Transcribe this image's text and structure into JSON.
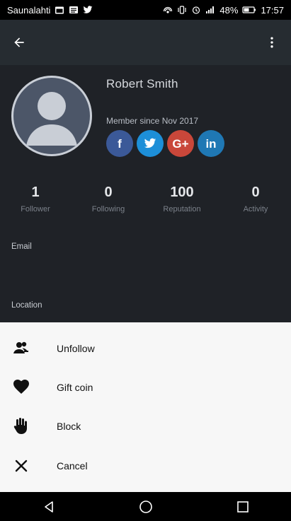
{
  "status": {
    "carrier": "Saunalahti",
    "battery": "48%",
    "time": "17:57"
  },
  "profile": {
    "name": "Robert Smith",
    "member_since": "Member since Nov 2017",
    "socials": [
      {
        "label": "f"
      },
      {
        "label": "t"
      },
      {
        "label": "G+"
      },
      {
        "label": "in"
      }
    ]
  },
  "stats": [
    {
      "value": "1",
      "label": "Follower"
    },
    {
      "value": "0",
      "label": "Following"
    },
    {
      "value": "100",
      "label": "Reputation"
    },
    {
      "value": "0",
      "label": "Activity"
    }
  ],
  "fields": {
    "email_label": "Email",
    "location_label": "Location"
  },
  "sheet": {
    "items": [
      {
        "label": "Unfollow",
        "icon": "unfollow-icon"
      },
      {
        "label": "Gift coin",
        "icon": "heart-icon"
      },
      {
        "label": "Block",
        "icon": "hand-icon"
      },
      {
        "label": "Cancel",
        "icon": "close-icon"
      }
    ]
  },
  "colors": {
    "background": "#1f2227",
    "toolbar": "#262c31",
    "facebook": "#3b5998",
    "twitter": "#1d8fd8",
    "google_plus": "#c9473a",
    "linkedin": "#1f78b4",
    "sheet": "#f7f7f7"
  }
}
